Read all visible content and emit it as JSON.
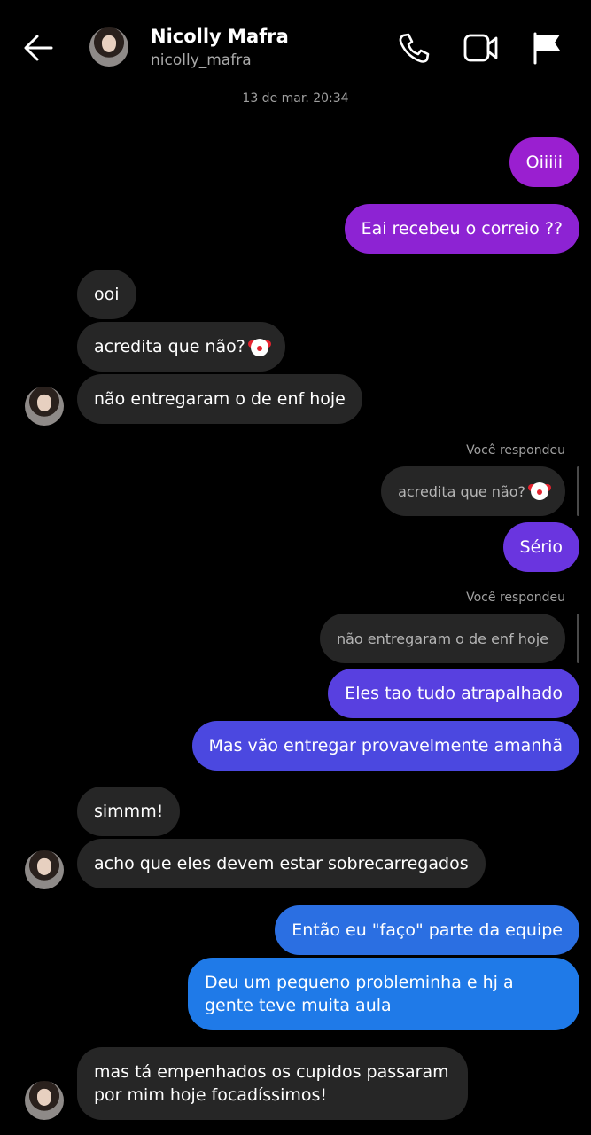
{
  "header": {
    "contact_name": "Nicolly Mafra",
    "contact_username": "nicolly_mafra",
    "icons": [
      "back-arrow-icon",
      "phone-icon",
      "video-camera-icon",
      "flag-icon"
    ]
  },
  "conversation": {
    "timestamp": "13 de mar. 20:34",
    "messages": [
      {
        "from": "me",
        "text": "Oiiiii"
      },
      {
        "from": "me",
        "text": "Eai recebeu o correio ??"
      },
      {
        "from": "contact",
        "text": "ooi"
      },
      {
        "from": "contact",
        "text": "acredita que não?",
        "emoji": "clown-face"
      },
      {
        "from": "contact",
        "text": "não entregaram o de enf hoje"
      },
      {
        "from": "me",
        "reply_label": "Você respondeu",
        "quoted": "acredita que não?",
        "quoted_emoji": "clown-face",
        "text": "Sério"
      },
      {
        "from": "me",
        "reply_label": "Você respondeu",
        "quoted": "não entregaram o de enf hoje",
        "text": "Eles tao tudo atrapalhado"
      },
      {
        "from": "me",
        "text": "Mas vão entregar provavelmente amanhã"
      },
      {
        "from": "contact",
        "text": "simmm!"
      },
      {
        "from": "contact",
        "text": "acho que eles devem estar sobrecarregados"
      },
      {
        "from": "me",
        "text": "Então eu \"faço\" parte da equipe"
      },
      {
        "from": "me",
        "text": "Deu um pequeno probleminha e hj a gente teve muita aula"
      },
      {
        "from": "contact",
        "text": "mas tá empenhados os cupidos passaram por mim hoje focadíssimos!"
      }
    ]
  },
  "colors": {
    "background": "#000000",
    "incoming_bubble": "#262626",
    "outgoing_gradient": [
      "#9a1fd0",
      "#7c3aed",
      "#4f46e5",
      "#2f6fe0",
      "#1f7ae8"
    ]
  }
}
